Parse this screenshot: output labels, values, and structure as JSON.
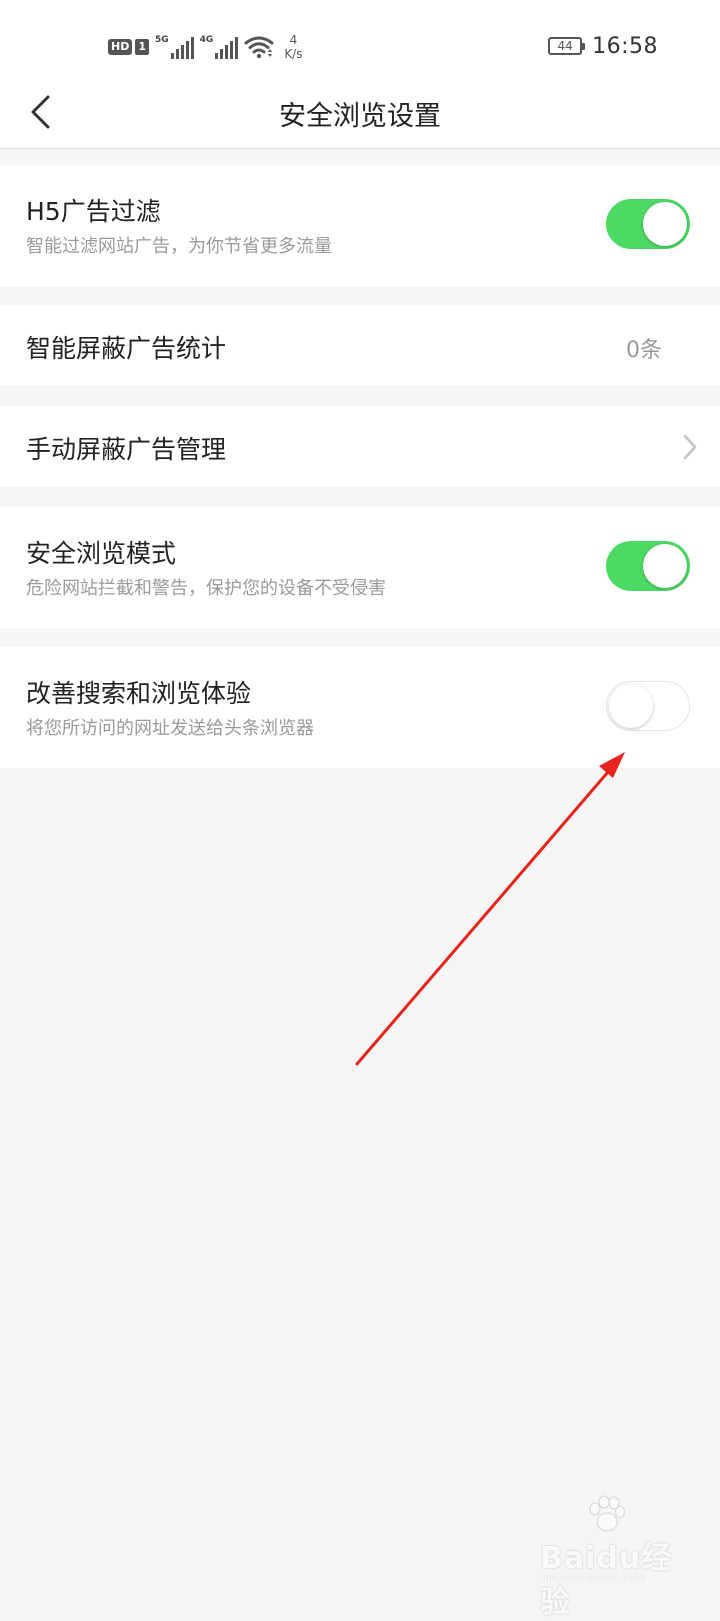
{
  "status_bar": {
    "hd_label": "HD",
    "sim_label": "1",
    "net1_label": "5G",
    "net2_label": "4G",
    "speed_value": "4",
    "speed_unit": "K/s",
    "battery_level": "44",
    "time": "16:58"
  },
  "nav": {
    "title": "安全浏览设置",
    "back_icon": "chevron-left-icon"
  },
  "settings": {
    "h5_filter": {
      "title": "H5广告过滤",
      "subtitle": "智能过滤网站广告，为你节省更多流量",
      "enabled": true
    },
    "ad_stats": {
      "title": "智能屏蔽广告统计",
      "value": "0条"
    },
    "manual_block": {
      "title": "手动屏蔽广告管理",
      "icon": "chevron-right-icon"
    },
    "safe_mode": {
      "title": "安全浏览模式",
      "subtitle": "危险网站拦截和警告，保护您的设备不受侵害",
      "enabled": true
    },
    "improve_experience": {
      "title": "改善搜索和浏览体验",
      "subtitle": "将您所访问的网址发送给头条浏览器",
      "enabled": false
    }
  },
  "colors": {
    "toggle_on": "#4cd964",
    "annotation_arrow": "#e8231b"
  },
  "watermark": {
    "brand": "Baidu经验",
    "site": "jingyan.baidu.com"
  }
}
